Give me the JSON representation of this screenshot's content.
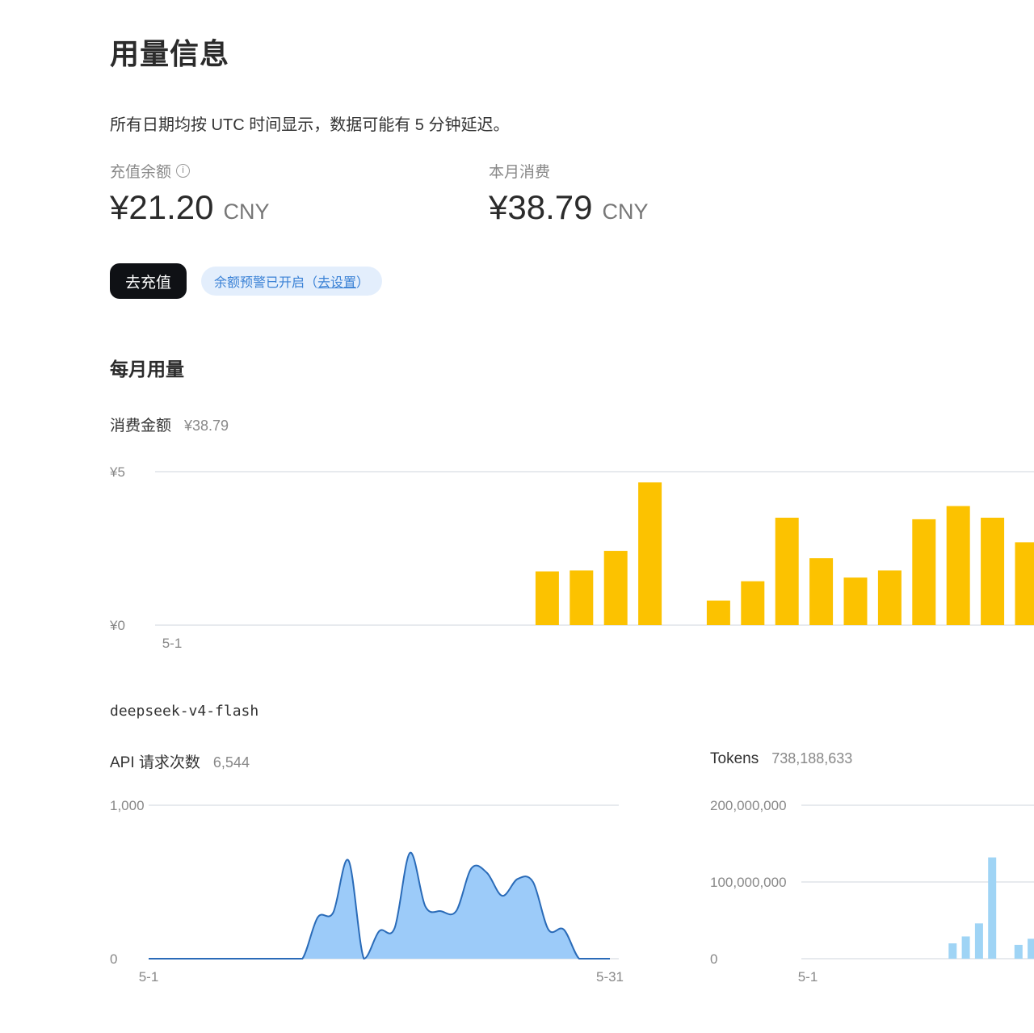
{
  "page": {
    "title": "用量信息",
    "notice": "所有日期均按 UTC 时间显示，数据可能有 5 分钟延迟。"
  },
  "balance": {
    "label": "充值余额",
    "info_icon": "info-icon",
    "value": "¥21.20",
    "unit": "CNY"
  },
  "monthly_spend": {
    "label": "本月消费",
    "value": "¥38.79",
    "unit": "CNY"
  },
  "actions": {
    "recharge_label": "去充值",
    "alert_prefix": "余额预警已开启（",
    "alert_link": "去设置",
    "alert_suffix": "）"
  },
  "monthly_usage": {
    "title": "每月用量"
  },
  "colors": {
    "spend_bar": "#fcc200",
    "requests_fill": "#9ccbf9",
    "requests_line": "#2a6bb8",
    "tokens_bar": "#9fd4f5",
    "primary_button": "#0f1115",
    "link": "#3b82d6"
  },
  "chart_data": [
    {
      "id": "spend",
      "type": "bar",
      "label": "消费金额",
      "total": "¥38.79",
      "y_ticks": [
        {
          "value": 0,
          "label": "¥0"
        },
        {
          "value": 5,
          "label": "¥5"
        }
      ],
      "ylim": [
        0,
        5
      ],
      "x_tick_labels": [
        {
          "day": 1,
          "label": "5-1"
        }
      ],
      "x_range": [
        1,
        31
      ],
      "days": [
        12,
        13,
        14,
        15,
        17,
        18,
        19,
        20,
        21,
        22,
        23,
        24,
        25,
        26
      ],
      "values": [
        1.75,
        1.78,
        2.42,
        4.65,
        0.8,
        1.43,
        3.5,
        2.18,
        1.55,
        1.78,
        3.45,
        3.88,
        3.5,
        2.7
      ]
    },
    {
      "id": "requests",
      "model": "deepseek-v4-flash",
      "type": "area",
      "label": "API 请求次数",
      "total": "6,544",
      "y_ticks": [
        {
          "value": 0,
          "label": "0"
        },
        {
          "value": 1000,
          "label": "1,000"
        }
      ],
      "ylim": [
        0,
        1000
      ],
      "x_tick_labels": [
        {
          "day": 1,
          "label": "5-1"
        },
        {
          "day": 31,
          "label": "5-31"
        }
      ],
      "x_range": [
        1,
        31
      ],
      "days": [
        1,
        2,
        3,
        4,
        5,
        6,
        7,
        8,
        9,
        10,
        11,
        12,
        13,
        14,
        15,
        16,
        17,
        18,
        19,
        20,
        21,
        22,
        23,
        24,
        25,
        26,
        27,
        28,
        29,
        30,
        31
      ],
      "values": [
        0,
        0,
        0,
        0,
        0,
        0,
        0,
        0,
        0,
        0,
        0,
        270,
        300,
        640,
        0,
        180,
        200,
        690,
        340,
        310,
        310,
        590,
        560,
        410,
        520,
        500,
        190,
        190,
        0,
        0,
        0
      ]
    },
    {
      "id": "tokens",
      "type": "bar",
      "label": "Tokens",
      "total": "738,188,633",
      "y_ticks": [
        {
          "value": 0,
          "label": "0"
        },
        {
          "value": 100000000,
          "label": "100,000,000"
        },
        {
          "value": 200000000,
          "label": "200,000,000"
        }
      ],
      "ylim": [
        0,
        200000000
      ],
      "x_tick_labels": [
        {
          "day": 1,
          "label": "5-1"
        }
      ],
      "x_range": [
        1,
        31
      ],
      "days": [
        12,
        13,
        14,
        15,
        17,
        18
      ],
      "values": [
        20000000,
        29000000,
        46000000,
        132000000,
        18000000,
        26000000
      ]
    }
  ]
}
